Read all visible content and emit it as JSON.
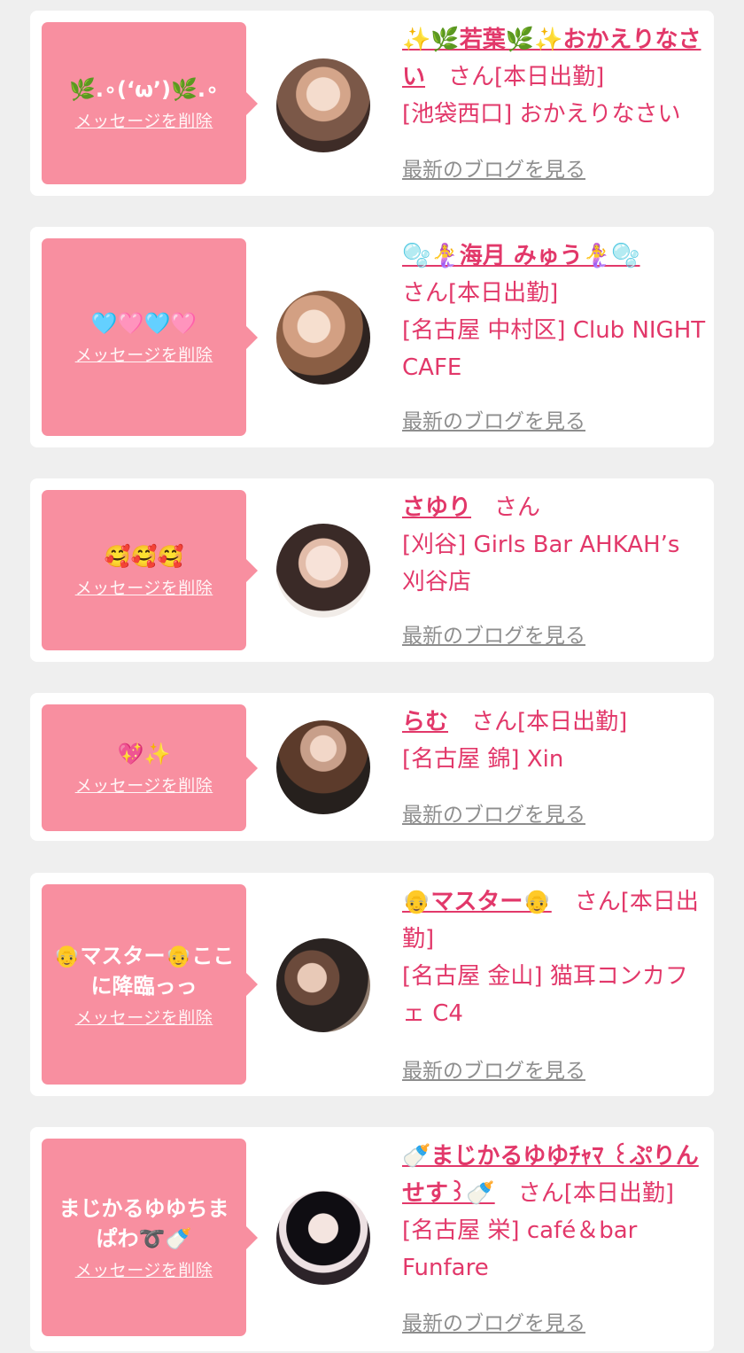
{
  "entries": [
    {
      "message": "🌿.∘(‘ω’)🌿.∘",
      "delete_label": "メッセージを削除",
      "name": "✨🌿若葉🌿✨おかえりなさい",
      "suffix": "　さん[本日出勤]",
      "shop": "[池袋西口] おかえりなさい",
      "blog_label": "最新のブログを見る"
    },
    {
      "message": "🩵🩷🩵🩷",
      "delete_label": "メッセージを削除",
      "name": "🫧🧜‍♀️海月 みゅう🧜‍♀️🫧",
      "suffix": "さん[本日出勤]",
      "shop": "[名古屋 中村区] Club NIGHT CAFE",
      "blog_label": "最新のブログを見る"
    },
    {
      "message": "🥰🥰🥰",
      "delete_label": "メッセージを削除",
      "name": "さゆり",
      "suffix": "　さん",
      "shop": "[刈谷] Girls Bar AHKAH’s 刈谷店",
      "blog_label": "最新のブログを見る"
    },
    {
      "message": "💖✨",
      "delete_label": "メッセージを削除",
      "name": "らむ",
      "suffix": "　さん[本日出勤]",
      "shop": "[名古屋 錦] Xin",
      "blog_label": "最新のブログを見る"
    },
    {
      "message": "👴マスター👴ここに降臨っっ",
      "delete_label": "メッセージを削除",
      "name": "👴マスター👴",
      "suffix": "　さん[本日出勤]",
      "shop": "[名古屋 金山] 猫耳コンカフェ C4",
      "blog_label": "最新のブログを見る"
    },
    {
      "message": "まじかるゆゆちまぱわ➰🍼",
      "delete_label": "メッセージを削除",
      "name": "🍼まじかるゆゆﾁｬﾏ ꒰ぷりんせす꒱🍼",
      "suffix": "　さん[本日出勤]",
      "shop": "[名古屋 栄] café＆bar Funfare",
      "blog_label": "最新のブログを見る"
    }
  ]
}
